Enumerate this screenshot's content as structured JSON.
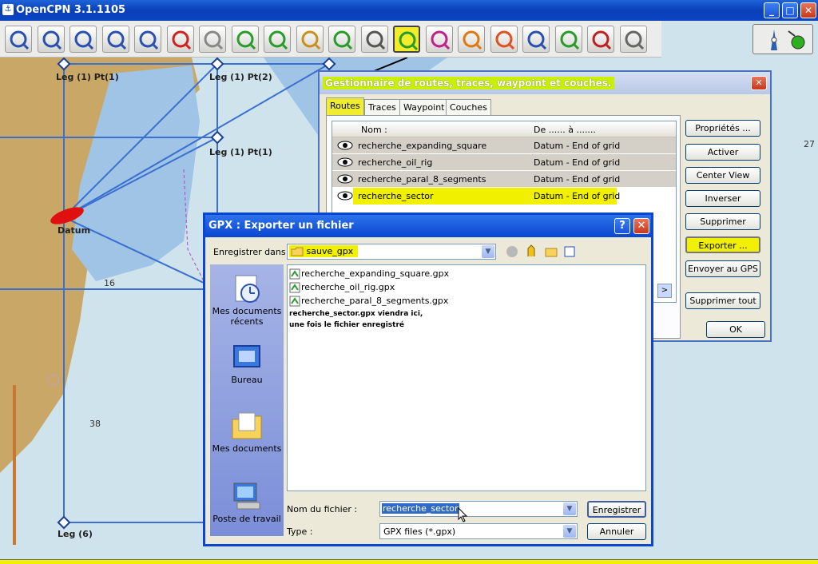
{
  "window": {
    "title": "OpenCPN 3.1.1105"
  },
  "toolbar": {
    "items": [
      "zoom-in-icon",
      "zoom-out-icon",
      "scale-in-icon",
      "scale-out-icon",
      "route-icon",
      "ship-icon",
      "settings-icon",
      "text-icon",
      "mark-icon",
      "tide-icon",
      "current-icon",
      "print-icon",
      "route-manager-icon",
      "track-icon",
      "sunset-icon",
      "lifebuoy-icon",
      "help-icon",
      "ais-icon",
      "mob-icon",
      "autotrack-icon"
    ]
  },
  "chart": {
    "labels": [
      "Leg (1) Pt(1)",
      "Leg (1) Pt(2)",
      "Leg (1) Pt(1)",
      "Datum",
      "Leg (6)"
    ],
    "depths": [
      "27",
      "38",
      "16"
    ]
  },
  "route_manager": {
    "title": "Gestionnaire de routes, traces, waypoint et couches.",
    "tabs": [
      "Routes",
      "Traces",
      "Waypoint",
      "Couches"
    ],
    "columns": {
      "name": "Nom :",
      "range": "De ...... à ......."
    },
    "rows": [
      {
        "name": "recherche_expanding_square",
        "range": "Datum - End of grid"
      },
      {
        "name": "recherche_oil_rig",
        "range": "Datum - End of grid"
      },
      {
        "name": "recherche_paral_8_segments",
        "range": "Datum - End of grid"
      },
      {
        "name": "recherche_sector",
        "range": "Datum - End of grid"
      }
    ],
    "buttons": [
      "Propriétés ...",
      "Activer",
      "Center View",
      "Inverser",
      "Supprimer",
      "Exporter ...",
      "Envoyer au GPS",
      "Supprimer tout"
    ],
    "ok": "OK"
  },
  "export_dialog": {
    "title": "GPX : Exporter un fichier",
    "save_in_label": "Enregistrer dans :",
    "save_in_value": "sauve_gpx",
    "places": [
      "Mes documents récents",
      "Bureau",
      "Mes documents",
      "Poste de travail"
    ],
    "files": [
      "recherche_expanding_square.gpx",
      "recherche_oil_rig.gpx",
      "recherche_paral_8_segments.gpx"
    ],
    "note_line1": "recherche_sector.gpx viendra ici,",
    "note_line2": "une fois le fichier enregistré",
    "filename_label": "Nom du fichier :",
    "filename_value": "recherche_sector",
    "type_label": "Type :",
    "type_value": "GPX files (*.gpx)",
    "save_button": "Enregistrer",
    "cancel_button": "Annuler"
  },
  "colors": {
    "highlight": "#f0f000",
    "titlebar": "#0a46d0",
    "land": "#c8a864",
    "water": "#cfe3ec"
  }
}
